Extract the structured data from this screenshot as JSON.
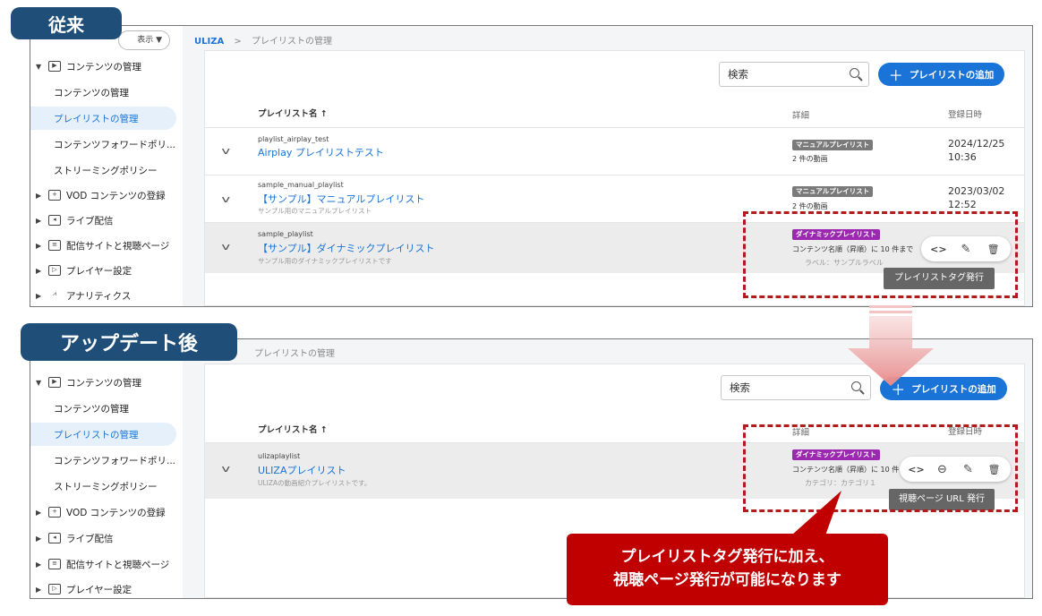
{
  "labels": {
    "before": "従来",
    "after": "アップデート後"
  },
  "colors": {
    "accent": "#1a73d6",
    "badge_bg": "#1f4e79",
    "highlight": "#b31b1b",
    "callout_bg": "#c00000",
    "dynamic_tag": "#9c27b0",
    "manual_tag": "#7a7a7a"
  },
  "before": {
    "display_toggle": "表示 ▼",
    "breadcrumb": {
      "root": "ULIZA",
      "sep": ">",
      "current": "プレイリストの管理"
    },
    "sidebar": [
      {
        "label": "コンテンツの管理",
        "icon": "content-icon"
      },
      {
        "label": "コンテンツの管理"
      },
      {
        "label": "プレイリストの管理"
      },
      {
        "label": "コンテンツフォワードポリ..."
      },
      {
        "label": "ストリーミングポリシー"
      },
      {
        "label": "VOD コンテンツの登録",
        "icon": "upload-icon"
      },
      {
        "label": "ライブ配信",
        "icon": "live-icon"
      },
      {
        "label": "配信サイトと視聴ページ",
        "icon": "site-icon"
      },
      {
        "label": "プレイヤー設定",
        "icon": "player-icon"
      },
      {
        "label": "アナリティクス",
        "icon": "analytics-icon"
      }
    ],
    "search": {
      "placeholder": "検索"
    },
    "add_button": "プレイリストの追加",
    "columns": {
      "name": "プレイリスト名 ↑",
      "detail": "詳細",
      "date": "登録日時"
    },
    "rows": [
      {
        "id": "playlist_airplay_test",
        "name": "Airplay プレイリストテスト",
        "desc": "",
        "tag": "マニュアルプレイリスト",
        "count": "2 件の動画",
        "date": "2024/12/25\n10:36"
      },
      {
        "id": "sample_manual_playlist",
        "name": "【サンプル】マニュアルプレイリスト",
        "desc": "サンプル用のマニュアルプレイリスト",
        "tag": "マニュアルプレイリスト",
        "count": "2 件の動画",
        "date": "2023/03/02\n12:52"
      },
      {
        "id": "sample_playlist",
        "name": "【サンプル】ダイナミックプレイリスト",
        "desc": "サンプル用のダイナミックプレイリストです",
        "tag": "ダイナミックプレイリスト",
        "count": "コンテンツ名順（昇順）に 10 件まで",
        "sub": "ラベル：サンプルラベル"
      }
    ],
    "tooltip": "プレイリストタグ発行"
  },
  "after": {
    "breadcrumb": {
      "current": "プレイリストの管理"
    },
    "sidebar": [
      {
        "label": "コンテンツの管理",
        "icon": "content-icon"
      },
      {
        "label": "コンテンツの管理"
      },
      {
        "label": "プレイリストの管理"
      },
      {
        "label": "コンテンツフォワードポリ..."
      },
      {
        "label": "ストリーミングポリシー"
      },
      {
        "label": "VOD コンテンツの登録",
        "icon": "upload-icon"
      },
      {
        "label": "ライブ配信",
        "icon": "live-icon"
      },
      {
        "label": "配信サイトと視聴ページ",
        "icon": "site-icon"
      },
      {
        "label": "プレイヤー設定",
        "icon": "player-icon"
      }
    ],
    "search": {
      "placeholder": "検索"
    },
    "add_button": "プレイリストの追加",
    "columns": {
      "name": "プレイリスト名 ↑",
      "detail": "詳細",
      "date": "登録日時"
    },
    "row": {
      "id": "ulizaplaylist",
      "name": "ULIZAプレイリスト",
      "desc": "ULIZAの動画紹介プレイリストです。",
      "tag": "ダイナミックプレイリスト",
      "count": "コンテンツ名順（昇順）に 10 件",
      "sub": "カテゴリ：カテゴリ１"
    },
    "tooltip": "視聴ページ URL 発行"
  },
  "callout": {
    "line1": "プレイリストタグ発行に加え、",
    "line2": "視聴ページ発行が可能になります"
  }
}
